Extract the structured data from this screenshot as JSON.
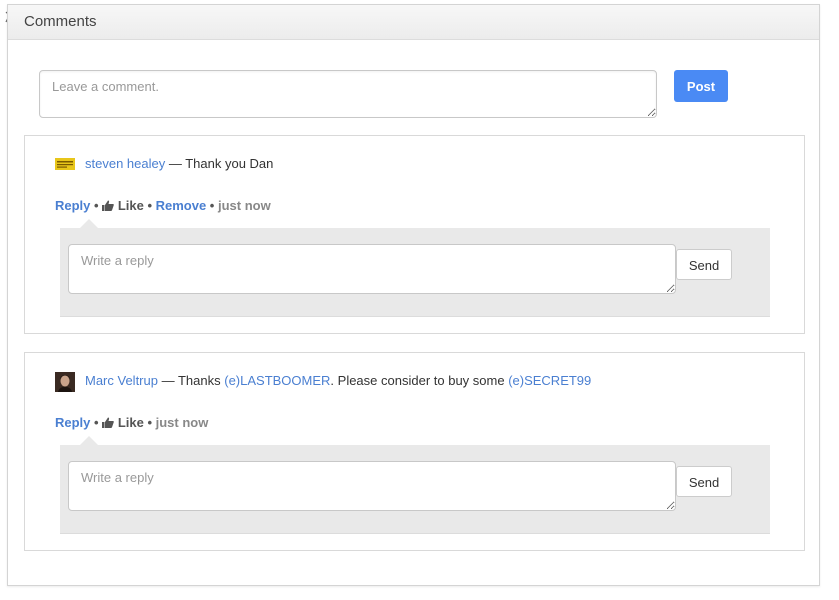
{
  "panel": {
    "title": "Comments"
  },
  "new_comment": {
    "placeholder": "Leave a comment.",
    "post_label": "Post"
  },
  "comments": [
    {
      "author": "steven healey",
      "dash": " — ",
      "text": "Thank you Dan",
      "actions": {
        "reply": "Reply",
        "sep1": " • ",
        "like": "Like",
        "sep2": " • ",
        "remove": "Remove",
        "sep3": " • ",
        "time": "just now"
      },
      "reply_placeholder": "Write a reply",
      "send_label": "Send"
    },
    {
      "author": "Marc Veltrup",
      "dash": " — ",
      "text_before": "Thanks ",
      "tag1": "(e)LASTBOOMER",
      "text_middle": ". Please consider to buy some ",
      "tag2": "(e)SECRET99",
      "actions": {
        "reply": "Reply",
        "sep1": " • ",
        "like": "Like",
        "sep2": " • ",
        "time": "just now"
      },
      "reply_placeholder": "Write a reply",
      "send_label": "Send"
    }
  ]
}
